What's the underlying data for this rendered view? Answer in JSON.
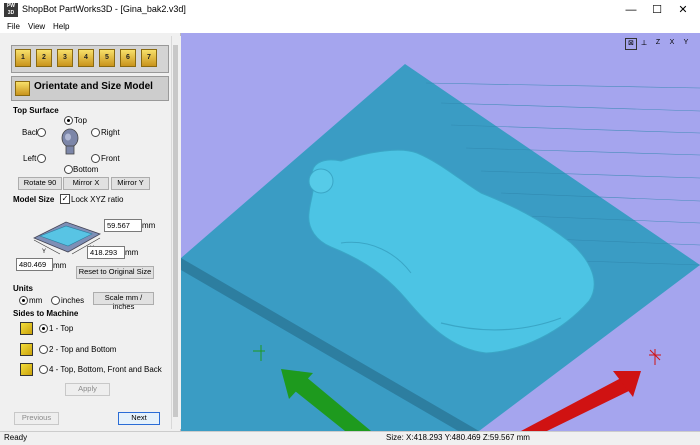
{
  "window": {
    "app_icon_text": "PW 3D",
    "title": "ShopBot PartWorks3D - [Gina_bak2.v3d]",
    "minimize": "—",
    "maximize": "☐",
    "close": "✕"
  },
  "menu": [
    "File",
    "View",
    "Help"
  ],
  "toolbar": {
    "step_buttons": [
      "1",
      "2",
      "3",
      "4",
      "5",
      "6",
      "7"
    ]
  },
  "stage": {
    "title": "Orientate and Size Model"
  },
  "top_surface": {
    "heading": "Top Surface",
    "options": {
      "top": "Top",
      "back": "Back",
      "right": "Right",
      "left": "Left",
      "front": "Front",
      "bottom": "Bottom"
    },
    "selected": "top",
    "buttons": {
      "rotate": "Rotate 90",
      "mirror_x": "Mirror X",
      "mirror_y": "Mirror Y"
    }
  },
  "model_size": {
    "heading": "Model Size",
    "lock_label": "Lock XYZ ratio",
    "lock_checked": true,
    "z_value": "59.567",
    "y_value": "418.293",
    "x_value": "480.469",
    "unit": "mm",
    "reset_button": "Reset to Original Size"
  },
  "units": {
    "heading": "Units",
    "mm": "mm",
    "inches": "inches",
    "selected": "mm",
    "scale_button": "Scale mm / inches"
  },
  "sides": {
    "heading": "Sides to Machine",
    "options": [
      "1 - Top",
      "2 - Top and Bottom",
      "4 - Top, Bottom, Front and Back"
    ],
    "selected_index": 0,
    "apply_button": "Apply"
  },
  "nav": {
    "previous": "Previous",
    "next": "Next"
  },
  "status": {
    "left": "Ready",
    "size": "Size: X:418.293 Y:480.469 Z:59.567 mm"
  },
  "view_icons": [
    "fit-view-icon",
    "iso-view-icon",
    "top-z-view-icon",
    "front-x-view-icon",
    "side-y-view-icon"
  ],
  "colors": {
    "viewport_bg": "#a5a5ee",
    "material_top": "#3e9fc6",
    "model": "#4fc6e6",
    "x_arrow": "#d01212",
    "y_arrow": "#1e9a1e"
  }
}
